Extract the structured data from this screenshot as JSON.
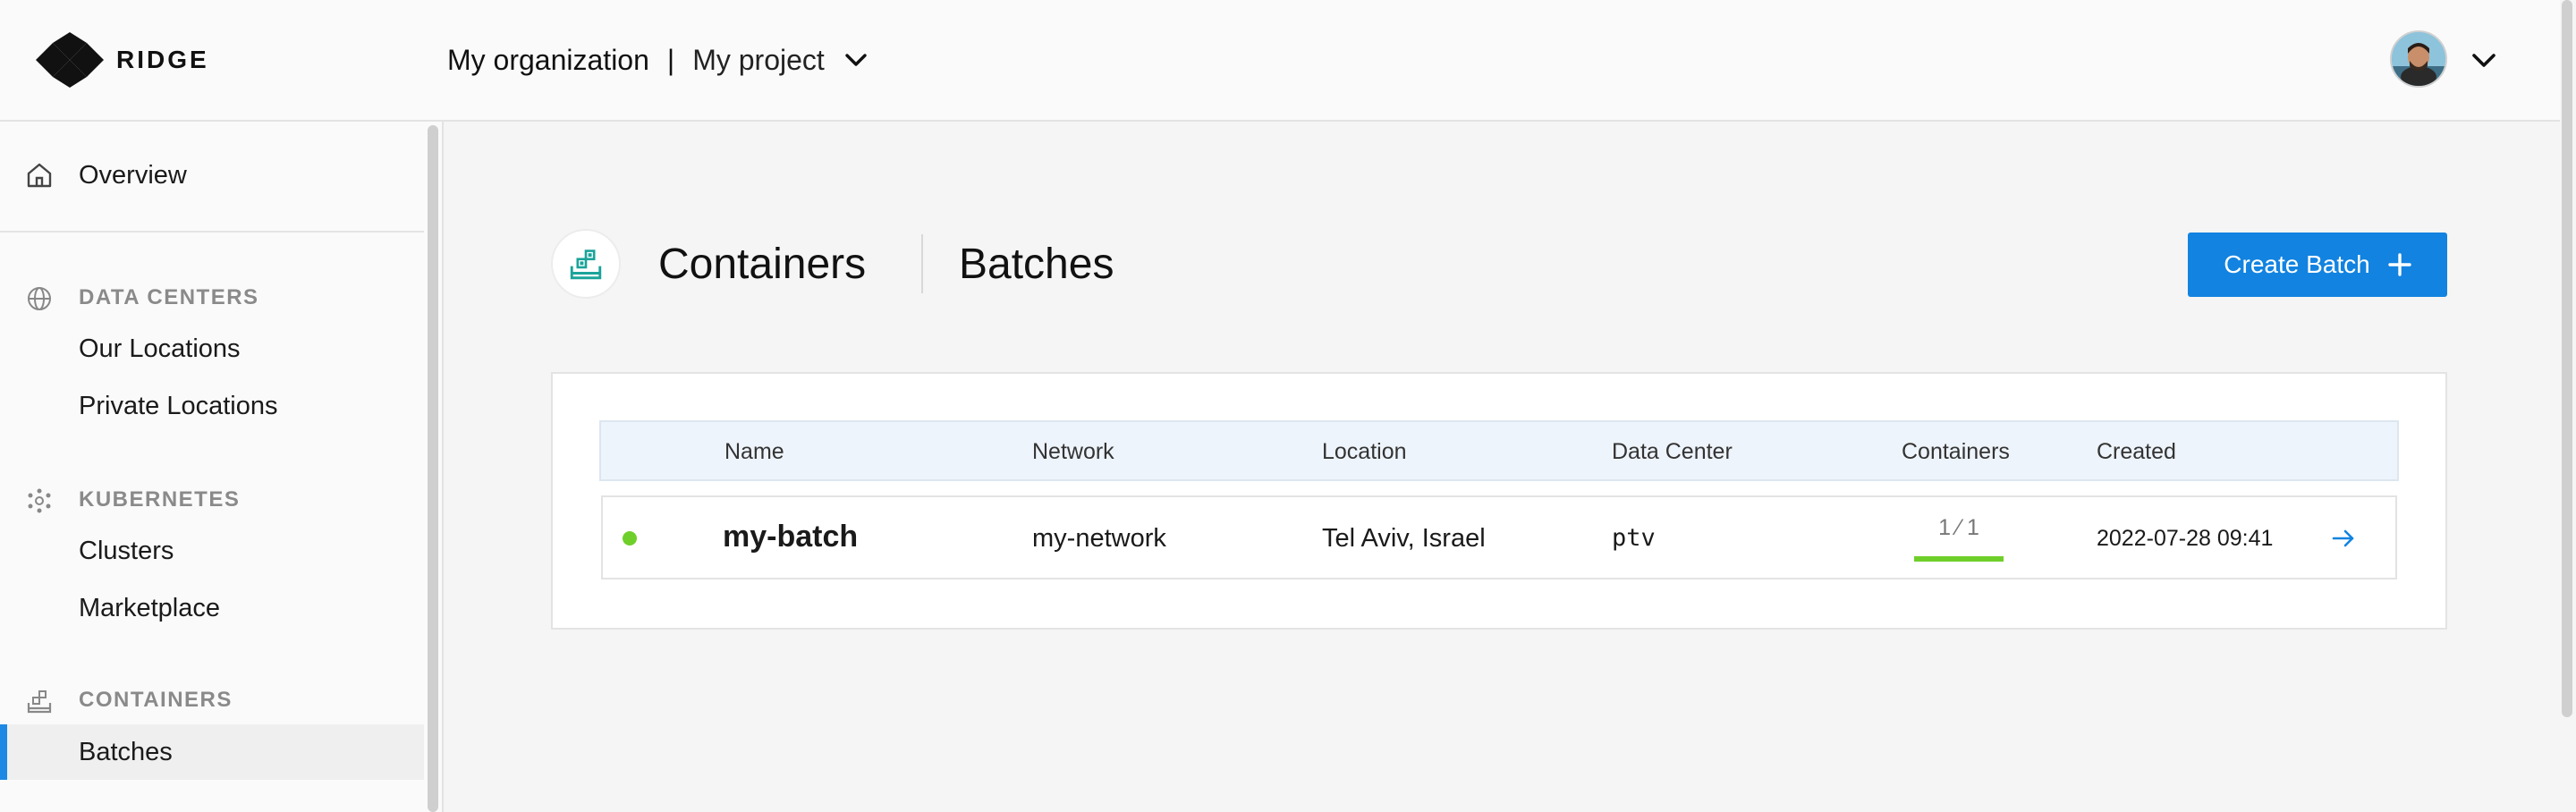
{
  "brand": {
    "name": "RIDGE"
  },
  "header": {
    "organization": "My organization",
    "separator": "|",
    "project": "My project"
  },
  "sidebar": {
    "overview": "Overview",
    "sections": [
      {
        "label": "DATA CENTERS",
        "items": [
          "Our Locations",
          "Private Locations"
        ]
      },
      {
        "label": "KUBERNETES",
        "items": [
          "Clusters",
          "Marketplace"
        ]
      },
      {
        "label": "CONTAINERS",
        "items": [
          "Batches"
        ]
      }
    ],
    "active_item": "Batches"
  },
  "main": {
    "title": "Containers",
    "subtitle": "Batches",
    "create_button": "Create Batch",
    "table": {
      "columns": [
        "Name",
        "Network",
        "Location",
        "Data Center",
        "Containers",
        "Created"
      ],
      "rows": [
        {
          "status": "running",
          "name": "my-batch",
          "network": "my-network",
          "location": "Tel Aviv, Israel",
          "data_center": "ptv",
          "containers": "1 ⁄ 1",
          "containers_fraction": 1.0,
          "created": "2022-07-28 09:41"
        }
      ]
    }
  },
  "colors": {
    "accent": "#1283e0",
    "status_ok": "#6fcf2a",
    "icon_teal": "#1aa39a"
  },
  "icons": {
    "overview": "home-icon",
    "data_centers": "globe-icon",
    "kubernetes": "kubernetes-icon",
    "containers": "containers-icon",
    "user_menu": "chevron-down-icon",
    "row_action": "arrow-right-icon"
  }
}
